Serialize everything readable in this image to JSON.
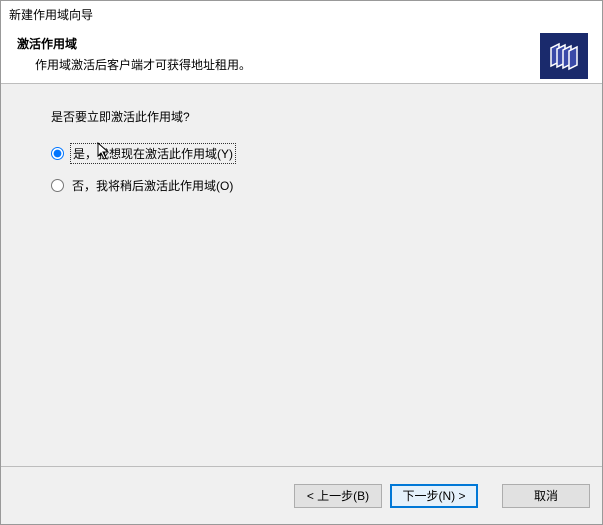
{
  "window": {
    "title": "新建作用域向导"
  },
  "header": {
    "title": "激活作用域",
    "description": "作用域激活后客户端才可获得地址租用。",
    "icon_name": "dhcp-scope-icon"
  },
  "content": {
    "prompt": "是否要立即激活此作用域?",
    "options": {
      "yes": {
        "label": "是，我想现在激活此作用域(Y)",
        "selected": true
      },
      "no": {
        "label": "否，我将稍后激活此作用域(O)",
        "selected": false
      }
    }
  },
  "footer": {
    "back": "< 上一步(B)",
    "next": "下一步(N) >",
    "cancel": "取消"
  }
}
